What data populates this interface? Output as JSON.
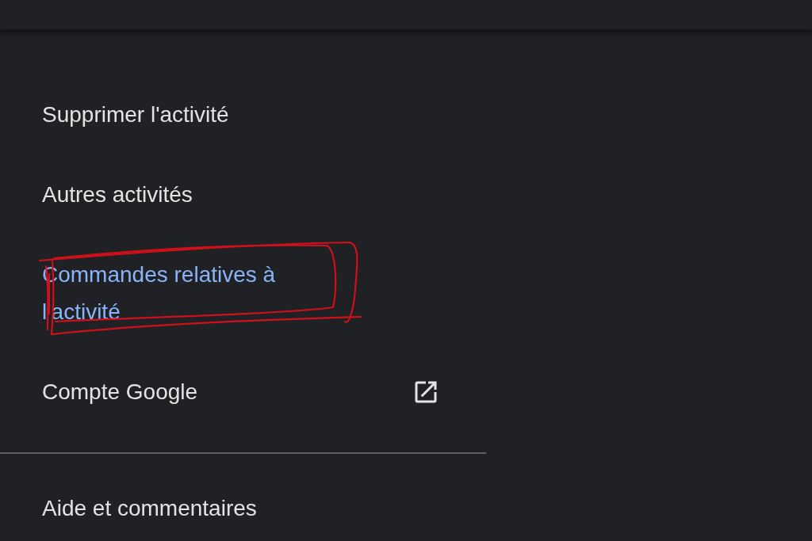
{
  "menu": {
    "items": [
      {
        "label": "Supprimer l'activité",
        "selected": false,
        "external": false,
        "annotated": false
      },
      {
        "label": "Autres activités",
        "selected": false,
        "external": false,
        "annotated": false
      },
      {
        "label": "Commandes relatives à l'activité",
        "selected": true,
        "external": false,
        "annotated": true
      },
      {
        "label": "Compte Google",
        "selected": false,
        "external": true,
        "annotated": false
      }
    ],
    "footer_items": [
      {
        "label": "Aide et commentaires",
        "selected": false,
        "external": false,
        "annotated": false
      }
    ]
  }
}
